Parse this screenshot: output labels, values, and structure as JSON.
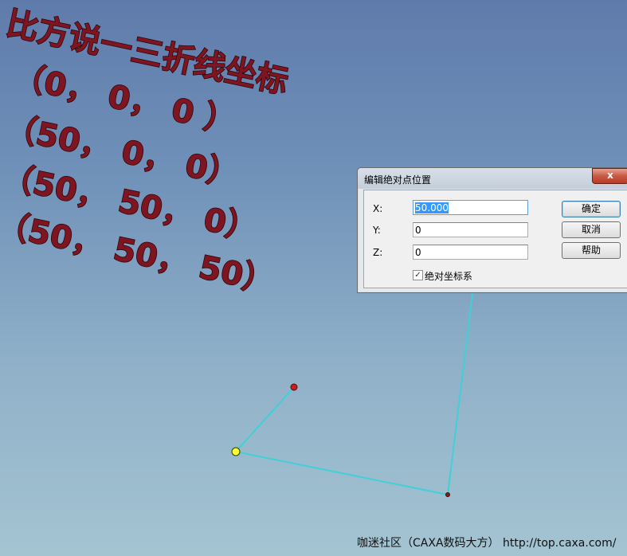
{
  "overlay": {
    "title": "比方说一三折线坐标",
    "coord_lines": [
      "（0，  0，  0 ）",
      "（50，  0，  0）",
      "（50，  50，  0）",
      "（50，  50，  50）"
    ]
  },
  "dialog": {
    "title": "编辑绝对点位置",
    "close_label": "x",
    "x_label": "X:",
    "x_value": "50.000",
    "y_label": "Y:",
    "y_value": "0",
    "z_label": "Z:",
    "z_value": "0",
    "ok_label": "确定",
    "cancel_label": "取消",
    "help_label": "帮助",
    "absolute_checkbox_label": "绝对坐标系",
    "absolute_checked": true
  },
  "footer": {
    "watermark": "咖迷社区（CAXA数码大方） http://top.caxa.com/"
  },
  "colors": {
    "polyline": "#3fd0d8",
    "point_red": "#c81e1e",
    "point_yellow": "#ffff30",
    "text_3d": "#7e1520"
  }
}
